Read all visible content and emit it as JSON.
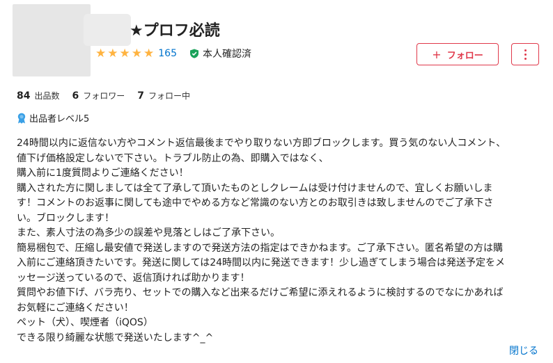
{
  "profile": {
    "name": "★プロフ必読",
    "rating_count": "165",
    "verified_label": "本人確認済",
    "follow_plus": "+",
    "follow_label": "フォロー"
  },
  "stats": [
    {
      "num": "84",
      "label": "出品数"
    },
    {
      "num": "6",
      "label": "フォロワー"
    },
    {
      "num": "7",
      "label": "フォロー中"
    }
  ],
  "level": {
    "label": "出品者レベル5"
  },
  "bio_lines": [
    "24時間以内に返信ない方やコメント返信最後までやり取りない方即ブロックします。買う気のない人コメント、",
    "値下げ価格設定しないで下さい。トラブル防止の為、即購入ではなく、",
    "購入前に1度質問よりご連絡ください！",
    "購入された方に関しましては全て了承して頂いたものとしクレームは受け付けませんので、宜しくお願いしま",
    "す！コメントのお返事に関しても途中でやめる方など常識のない方とのお取引きは致しませんのでご了承下さ",
    "い。ブロックします！",
    "また、素人寸法の為多少の誤差や見落としはご了承下さい。",
    "簡易梱包で、圧縮し最安値で発送しますので発送方法の指定はできかねます。ご了承下さい。匿名希望の方は購",
    "入前にご連絡頂きたいです。発送に関しては24時間以内に発送できます！少し過ぎてしまう場合は発送予定をメ",
    "ッセージ送っているので、返信頂ければ助かります！",
    "質問やお値下げ、バラ売り、セットでの購入など出来るだけご希望に添えれるように検討するのでなにかあれば",
    "お気軽にご連絡ください！",
    "ペット（犬）、喫煙者（iQOS）",
    "できる限り綺麗な状態で発送いたします^_^"
  ],
  "close_label": "閉じる",
  "colors": {
    "accent": "#e0384a",
    "link": "#0073cc",
    "star": "#ffb340",
    "verified": "#1aa25a",
    "level_badge": "#3aa0e6"
  },
  "rating_stars": 5
}
